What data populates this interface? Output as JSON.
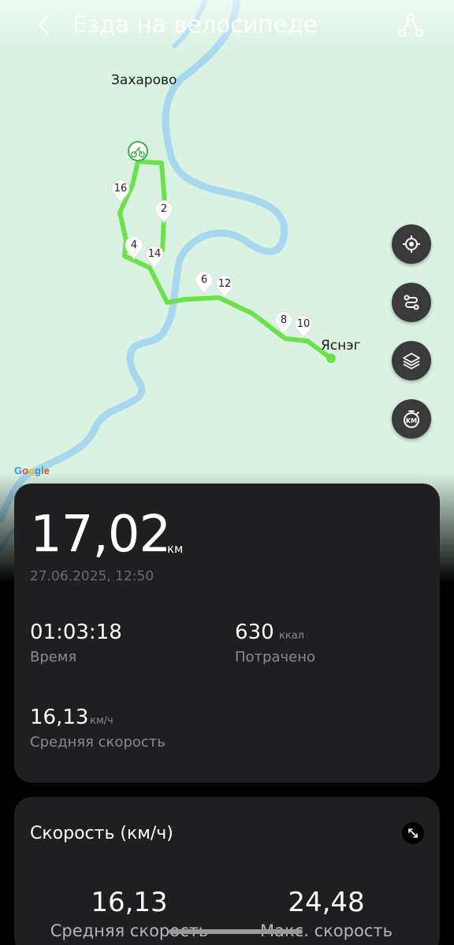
{
  "header": {
    "title": "Езда на велосипеде",
    "back_icon": "chevron-left-icon",
    "route_icon": "route-icon"
  },
  "map": {
    "places": [
      "Захарово",
      "Яснэг"
    ],
    "attribution": "Google",
    "route_color": "#6ce24a",
    "river_color": "#a7d8ee",
    "land_color": "#d9f2e2",
    "km_markers": [
      "16",
      "2",
      "4",
      "14",
      "6",
      "12",
      "8",
      "10"
    ],
    "start_icon": "bicycle-start-icon",
    "controls": [
      {
        "name": "locate-button",
        "icon": "crosshair-icon"
      },
      {
        "name": "route-view-button",
        "icon": "route-path-icon"
      },
      {
        "name": "layers-button",
        "icon": "layers-icon"
      },
      {
        "name": "km-marker-button",
        "icon": "km-timer-icon",
        "label": "KM"
      }
    ]
  },
  "summary": {
    "distance": "17,02",
    "distance_unit": "км",
    "datetime": "27.06.2025, 12:50",
    "duration": {
      "value": "01:03:18",
      "label": "Время"
    },
    "calories": {
      "value": "630",
      "unit": "ккал",
      "label": "Потрачено"
    },
    "avg_speed": {
      "value": "16,13",
      "unit": "км/ч",
      "label": "Средняя скорость"
    }
  },
  "speed": {
    "title": "Скорость (км/ч)",
    "avg": {
      "value": "16,13",
      "label": "Средняя скорость"
    },
    "max": {
      "value": "24,48",
      "label": "Макс. скорость"
    },
    "expand_icon": "expand-icon"
  },
  "colors": {
    "card_bg": "#1f1f21",
    "fab_bg": "#3a3a3c",
    "secondary_text": "#8a8a8f"
  }
}
